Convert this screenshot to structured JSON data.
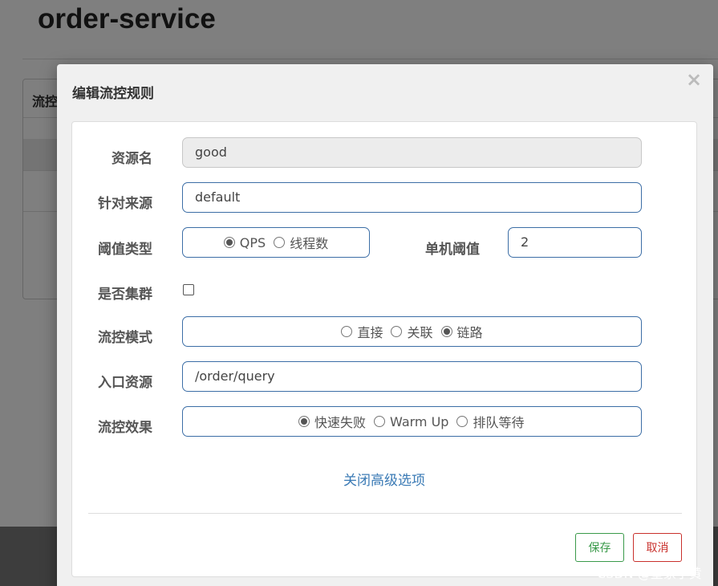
{
  "background": {
    "page_title": "order-service",
    "panel_header": "流控"
  },
  "modal": {
    "title": "编辑流控规则",
    "close_glyph": "×",
    "fields": {
      "resource": {
        "label": "资源名",
        "value": "good"
      },
      "limit_app": {
        "label": "针对来源",
        "value": "default"
      },
      "grade": {
        "label": "阈值类型",
        "options": [
          "QPS",
          "线程数"
        ],
        "selected": "QPS"
      },
      "count": {
        "label": "单机阈值",
        "value": "2"
      },
      "cluster": {
        "label": "是否集群",
        "checked": false
      },
      "strategy": {
        "label": "流控模式",
        "options": [
          "直接",
          "关联",
          "链路"
        ],
        "selected": "链路"
      },
      "ref_resource": {
        "label": "入口资源",
        "value": "/order/query"
      },
      "control_behavior": {
        "label": "流控效果",
        "options": [
          "快速失败",
          "Warm Up",
          "排队等待"
        ],
        "selected": "快速失败"
      }
    },
    "advanced_link": "关闭高级选项",
    "buttons": {
      "save": "保存",
      "cancel": "取消"
    }
  },
  "watermark": "CSDN @皇家小黄"
}
